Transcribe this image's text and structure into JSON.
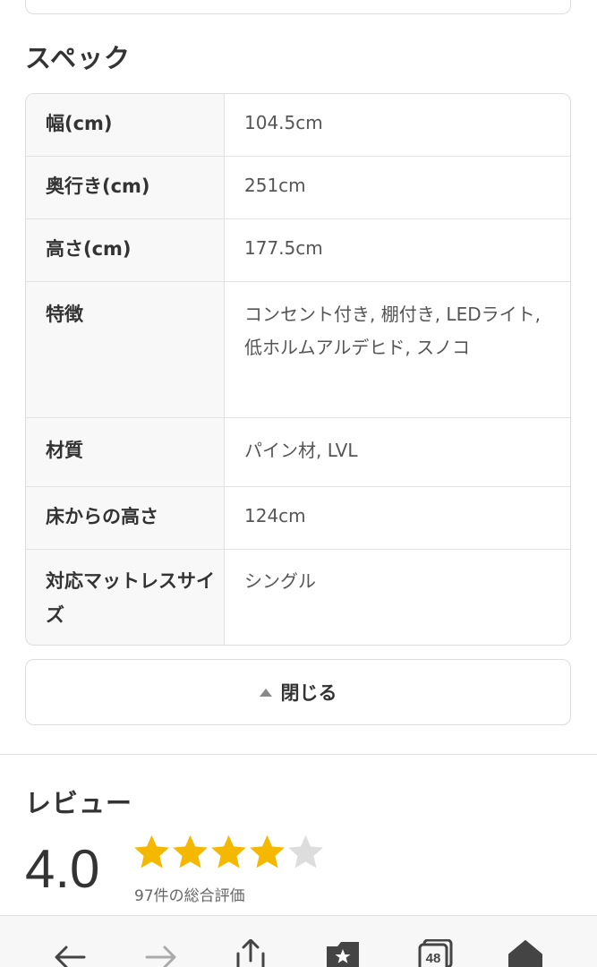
{
  "spec_section": {
    "title": "スペック"
  },
  "spec_rows": [
    {
      "key": "幅(cm)",
      "value": "104.5cm"
    },
    {
      "key": "奥行き(cm)",
      "value": "251cm"
    },
    {
      "key": "高さ(cm)",
      "value": "177.5cm"
    },
    {
      "key": "特徴",
      "value": "コンセント付き, 棚付き, LEDライト, 低ホルムアルデヒド, スノコ"
    },
    {
      "key": "材質",
      "value": "パイン材, LVL"
    },
    {
      "key": "床からの高さ",
      "value": "124cm"
    },
    {
      "key": "対応マットレスサイズ",
      "value": "シングル"
    }
  ],
  "close_button": {
    "label": "閉じる"
  },
  "review_section": {
    "title": "レビュー",
    "score": "4.0",
    "rating": 4,
    "rating_max": 5,
    "count_text": "97件の総合評価"
  },
  "colors": {
    "star_filled": "#f5b800",
    "star_empty": "#dddddd",
    "border": "#dcdcdc"
  },
  "bottom_nav": {
    "tab_count": "48",
    "icons": [
      "back-arrow-icon",
      "forward-arrow-icon",
      "share-icon",
      "bookmark-star-icon",
      "tabs-icon",
      "home-icon"
    ]
  }
}
